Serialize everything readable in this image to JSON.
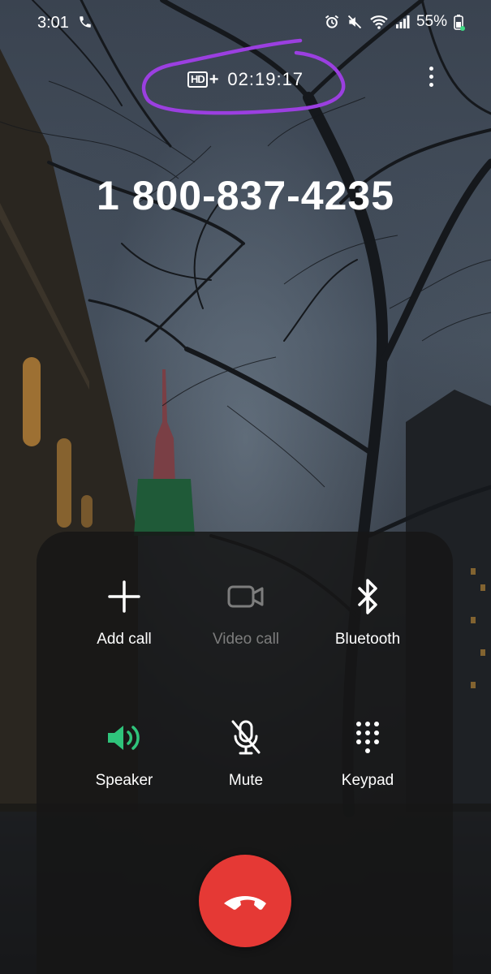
{
  "status_bar": {
    "time": "3:01",
    "battery": "55%",
    "icons": [
      "phone-icon",
      "alarm-icon",
      "mute-icon",
      "wifi-icon",
      "signal-icon",
      "battery-icon"
    ]
  },
  "call": {
    "hd_badge": "HD",
    "hd_plus": "+",
    "duration": "02:19:17",
    "number": "1 800-837-4235"
  },
  "controls": [
    {
      "label": "Add call",
      "icon": "plus-icon",
      "enabled": true
    },
    {
      "label": "Video call",
      "icon": "video-camera-icon",
      "enabled": false
    },
    {
      "label": "Bluetooth",
      "icon": "bluetooth-icon",
      "enabled": true
    },
    {
      "label": "Speaker",
      "icon": "speaker-icon",
      "enabled": true,
      "active": true
    },
    {
      "label": "Mute",
      "icon": "mic-off-icon",
      "enabled": true
    },
    {
      "label": "Keypad",
      "icon": "keypad-icon",
      "enabled": true
    }
  ],
  "colors": {
    "speaker_active": "#2fc47b",
    "end_call": "#e53935",
    "annotation": "#9b3fe0"
  }
}
